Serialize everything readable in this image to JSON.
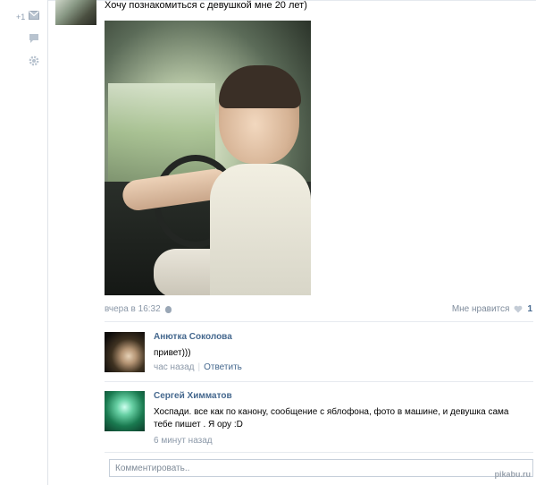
{
  "sidebar": {
    "plus_label": "+1",
    "icons": [
      "envelope-icon",
      "comment-icon",
      "gear-icon"
    ]
  },
  "post": {
    "text": "Хочу познакомиться с девушкой мне 20 лет)",
    "time": "вчера в 16:32",
    "likes_label": "Мне нравится",
    "likes_count": "1"
  },
  "comments": [
    {
      "author": "Анютка Соколова",
      "text": "привет)))",
      "time": "час назад",
      "reply_label": "Ответить"
    },
    {
      "author": "Сергей Химматов",
      "text": "Хоспади. все как по канону, сообщение с яблофона, фото в машине, и девушка сама тебе пишет . Я ору :D",
      "time": "6 минут назад"
    }
  ],
  "comment_input": {
    "placeholder": "Комментировать.."
  },
  "watermark": "pikabu.ru",
  "colors": {
    "link": "#45688e",
    "meta": "#8b98a8",
    "divider": "#e6eaef"
  }
}
